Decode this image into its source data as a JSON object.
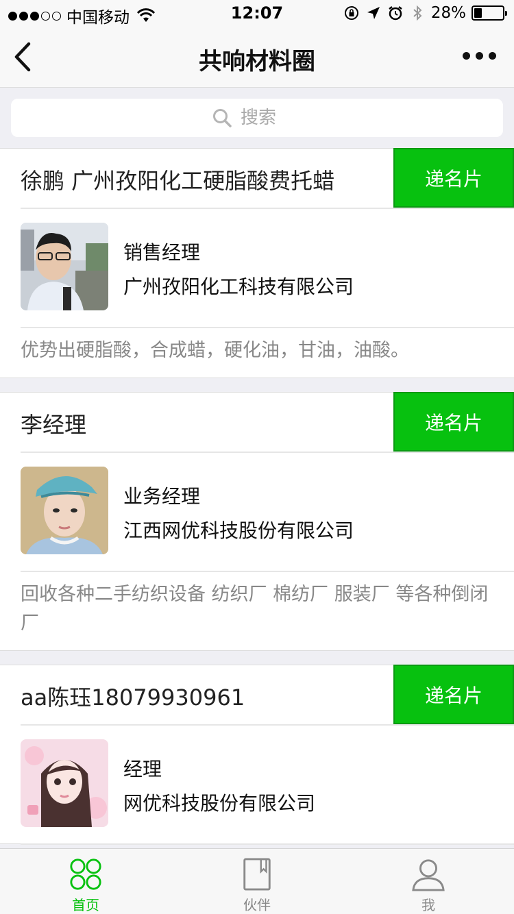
{
  "status_bar": {
    "carrier": "中国移动",
    "time": "12:07",
    "battery_percent": "28%",
    "battery_level": 0.28,
    "icons": [
      "signal-icon",
      "wifi-icon",
      "rotation-lock-icon",
      "location-icon",
      "alarm-icon",
      "bluetooth-icon",
      "battery-icon"
    ]
  },
  "nav": {
    "title": "共响材料圈",
    "back_icon": "back-chevron-icon",
    "more_icon": "more-dots-icon"
  },
  "search": {
    "placeholder": "搜索",
    "icon": "search-icon"
  },
  "cards": [
    {
      "title": "徐鹏 广州孜阳化工硬脂酸费托蜡",
      "button": "递名片",
      "role": "销售经理",
      "company": "广州孜阳化工科技有限公司",
      "description": "优势出硬脂酸，合成蜡，硬化油，甘油，油酸。"
    },
    {
      "title": "李经理",
      "button": "递名片",
      "role": "业务经理",
      "company": "江西网优科技股份有限公司",
      "description": "回收各种二手纺织设备 纺织厂 棉纺厂 服装厂 等各种倒闭厂"
    },
    {
      "title": "aa陈珏18079930961",
      "button": "递名片",
      "role": "经理",
      "company": "网优科技股份有限公司",
      "description": ""
    }
  ],
  "tabs": [
    {
      "label": "首页",
      "icon": "home-grid-icon",
      "active": true
    },
    {
      "label": "伙伴",
      "icon": "book-icon",
      "active": false
    },
    {
      "label": "我",
      "icon": "person-icon",
      "active": false
    }
  ],
  "colors": {
    "accent_green": "#07c10f",
    "background": "#efeff4"
  }
}
